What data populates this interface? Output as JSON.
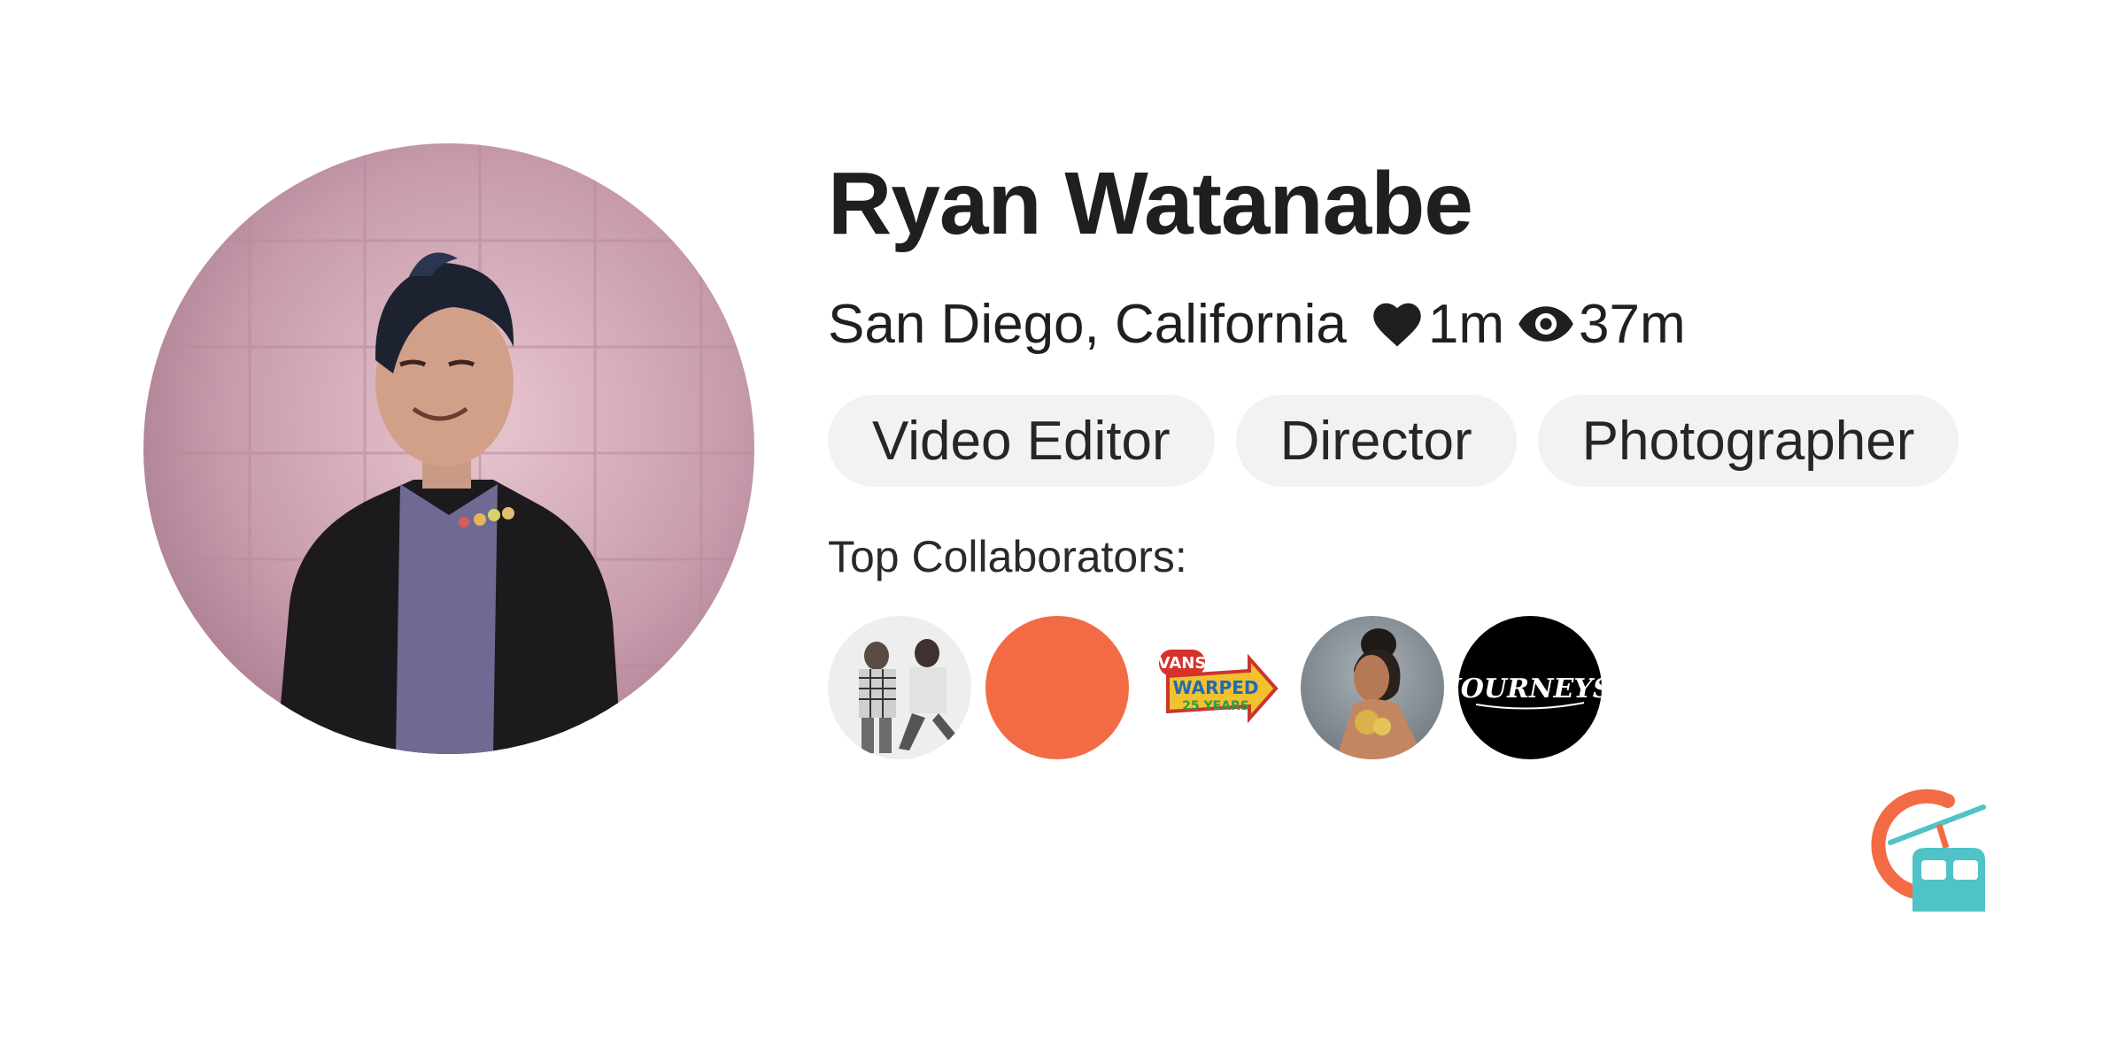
{
  "profile": {
    "name": "Ryan Watanabe",
    "location": "San Diego, California",
    "likes": "1m",
    "views": "37m"
  },
  "roles": [
    "Video Editor",
    "Director",
    "Photographer"
  ],
  "collaborators": {
    "title": "Top Collaborators:",
    "items": [
      {
        "id": "duo-dancers"
      },
      {
        "id": "orange-circle",
        "color": "#f26b45"
      },
      {
        "id": "vans-warped-tour",
        "logo_text": "VANS WARPED 25 YEARS"
      },
      {
        "id": "singer-portrait"
      },
      {
        "id": "journeys",
        "logo_text": "JOURNEYS"
      }
    ]
  },
  "colors": {
    "accent_orange": "#f26b45",
    "accent_teal": "#4fc3c7",
    "tag_bg": "#f2f2f2",
    "text": "#1f1f1f"
  }
}
